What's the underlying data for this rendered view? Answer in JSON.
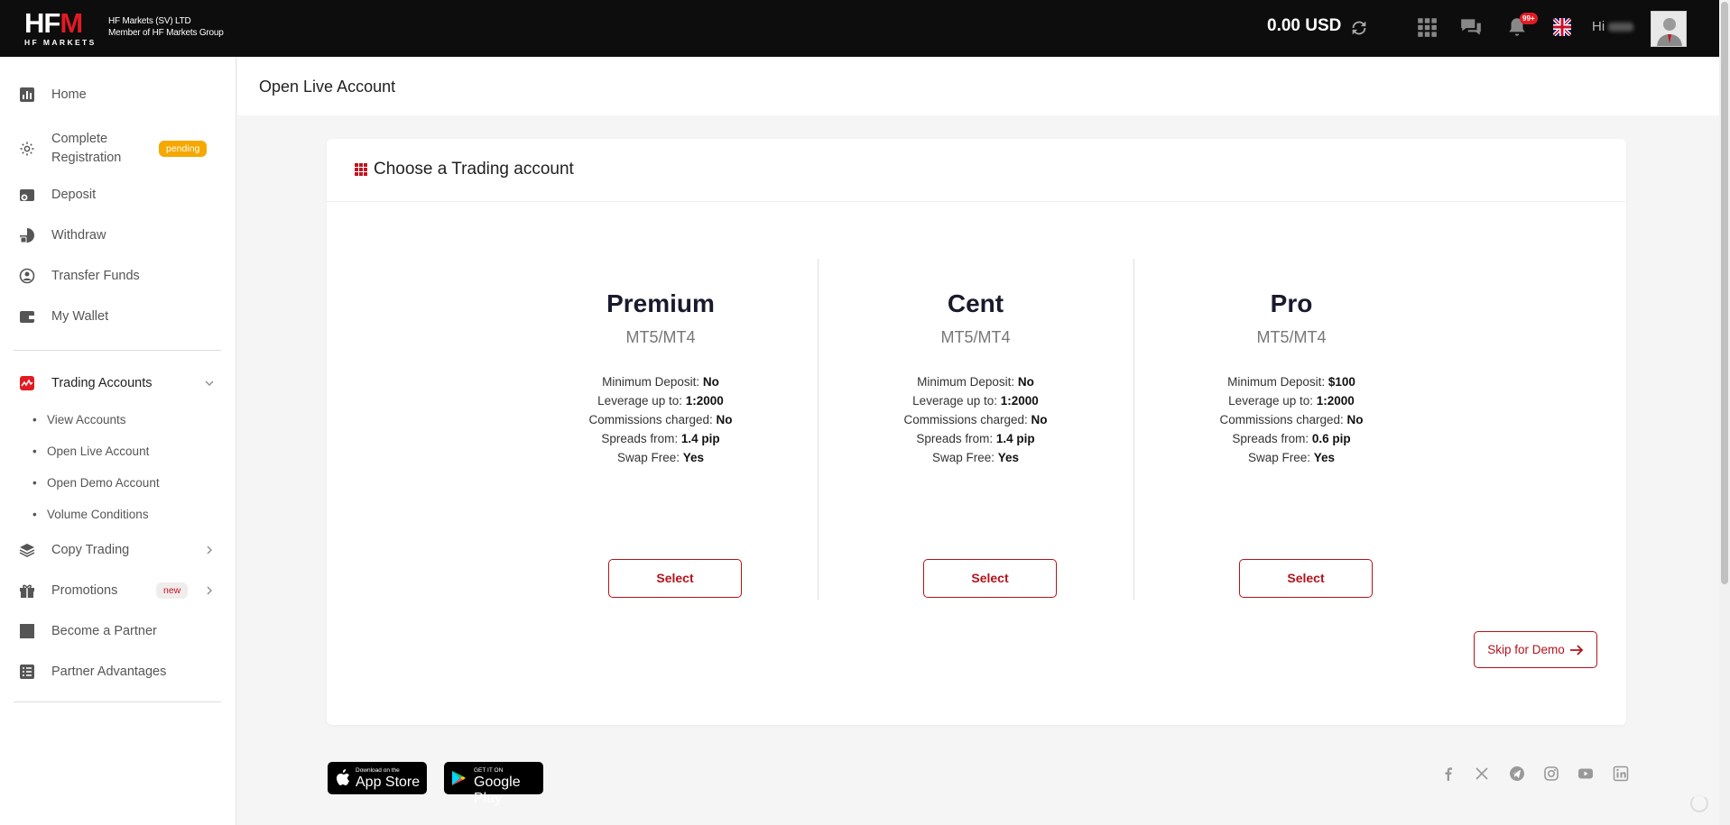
{
  "header": {
    "logo_text": "HFM",
    "logo_sub": "HF MARKETS",
    "company_line1": "HF Markets (SV) LTD",
    "company_line2": "Member of HF Markets Group",
    "balance": "0.00 USD",
    "notification_count": "99+",
    "greeting": "Hi"
  },
  "sidebar": {
    "items": [
      {
        "label": "Home",
        "icon": "chart-icon"
      },
      {
        "label": "Complete Registration",
        "icon": "gear-icon",
        "badge": "pending"
      },
      {
        "label": "Deposit",
        "icon": "deposit-icon"
      },
      {
        "label": "Withdraw",
        "icon": "withdraw-icon"
      },
      {
        "label": "Transfer Funds",
        "icon": "transfer-icon"
      },
      {
        "label": "My Wallet",
        "icon": "wallet-icon"
      }
    ],
    "trading": {
      "label": "Trading Accounts",
      "sub": [
        "View Accounts",
        "Open Live Account",
        "Open Demo Account",
        "Volume Conditions"
      ]
    },
    "lower": [
      {
        "label": "Copy Trading",
        "icon": "layers-icon"
      },
      {
        "label": "Promotions",
        "icon": "gift-icon",
        "badge": "new"
      },
      {
        "label": "Become a Partner",
        "icon": "square-icon"
      },
      {
        "label": "Partner Advantages",
        "icon": "list-icon"
      }
    ]
  },
  "page": {
    "title": "Open Live Account",
    "card_title": "Choose a Trading account",
    "skip_label": "Skip for Demo"
  },
  "accounts": [
    {
      "name": "Premium",
      "platform": "MT5/MT4",
      "features": [
        {
          "label": "Minimum Deposit:",
          "value": "No"
        },
        {
          "label": "Leverage up to:",
          "value": "1:2000"
        },
        {
          "label": "Commissions charged:",
          "value": "No"
        },
        {
          "label": "Spreads from:",
          "value": "1.4 pip"
        },
        {
          "label": "Swap Free:",
          "value": "Yes"
        }
      ],
      "button": "Select"
    },
    {
      "name": "Cent",
      "platform": "MT5/MT4",
      "features": [
        {
          "label": "Minimum Deposit:",
          "value": "No"
        },
        {
          "label": "Leverage up to:",
          "value": "1:2000"
        },
        {
          "label": "Commissions charged:",
          "value": "No"
        },
        {
          "label": "Spreads from:",
          "value": "1.4 pip"
        },
        {
          "label": "Swap Free:",
          "value": "Yes"
        }
      ],
      "button": "Select"
    },
    {
      "name": "Pro",
      "platform": "MT5/MT4",
      "features": [
        {
          "label": "Minimum Deposit:",
          "value": "$100"
        },
        {
          "label": "Leverage up to:",
          "value": "1:2000"
        },
        {
          "label": "Commissions charged:",
          "value": "No"
        },
        {
          "label": "Spreads from:",
          "value": "0.6 pip"
        },
        {
          "label": "Swap Free:",
          "value": "Yes"
        }
      ],
      "button": "Select"
    }
  ],
  "footer": {
    "appstore_small": "Download on the",
    "appstore_big": "App Store",
    "googleplay_small": "GET IT ON",
    "googleplay_big": "Google Play",
    "social": [
      "facebook-icon",
      "x-icon",
      "telegram-icon",
      "instagram-icon",
      "youtube-icon",
      "linkedin-icon"
    ]
  },
  "colors": {
    "brand_red": "#b5121b",
    "pending": "#f5a800",
    "topbar": "#0d0d0d"
  }
}
